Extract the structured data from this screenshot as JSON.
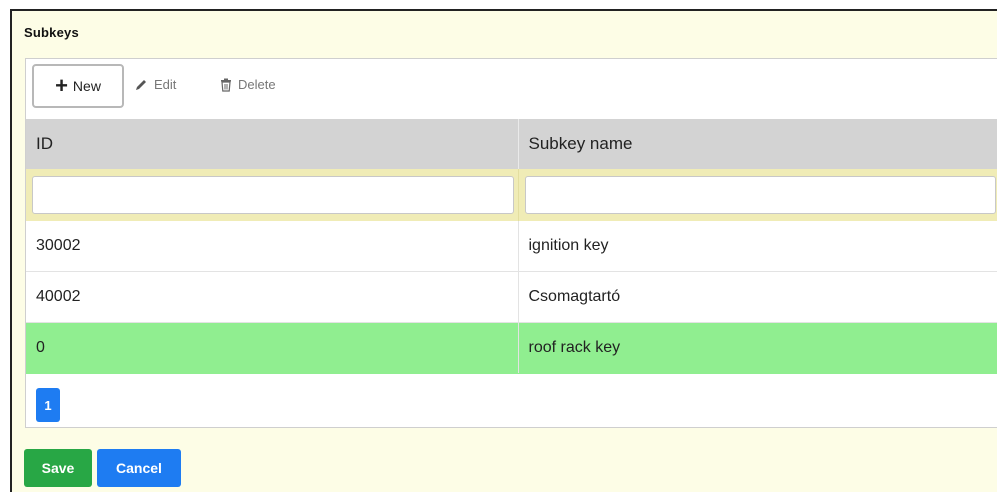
{
  "panel": {
    "title": "Subkeys"
  },
  "toolbar": {
    "new_label": "New",
    "edit_label": "Edit",
    "delete_label": "Delete"
  },
  "table": {
    "columns": [
      "ID",
      "Subkey name"
    ],
    "filters": [
      {
        "value": "",
        "placeholder": ""
      },
      {
        "value": "",
        "placeholder": ""
      }
    ],
    "rows": [
      {
        "id": "30002",
        "name": "ignition key",
        "selected": false
      },
      {
        "id": "40002",
        "name": "Csomagtartó",
        "selected": false
      },
      {
        "id": "0",
        "name": "roof rack key",
        "selected": true
      }
    ]
  },
  "pager": {
    "current_page": "1"
  },
  "actions": {
    "save_label": "Save",
    "cancel_label": "Cancel"
  },
  "colors": {
    "panel_bg": "#fdfde6",
    "header_bg": "#d3d3d3",
    "filter_bg": "#f0ecb6",
    "selected_row": "#90ee90",
    "primary": "#1e7cf2",
    "success": "#28a745"
  },
  "icons": {
    "new": "plus-icon",
    "edit": "pencil-icon",
    "delete": "trash-icon"
  }
}
